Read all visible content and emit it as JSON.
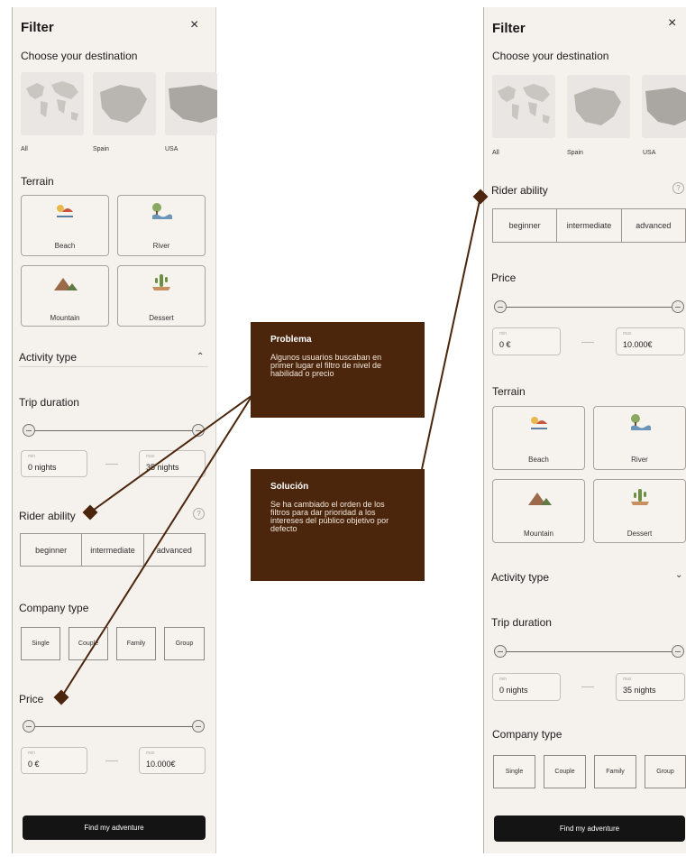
{
  "filter_title": "Filter",
  "close_glyph": "×",
  "destination_heading": "Choose your destination",
  "destinations": [
    "All",
    "Spain",
    "USA"
  ],
  "terrain_heading": "Terrain",
  "terrains": [
    "Beach",
    "River",
    "Mountain",
    "Dessert"
  ],
  "activity_heading": "Activity type",
  "trip_heading": "Trip duration",
  "trip_min_label": "min",
  "trip_max_label": "max",
  "trip_min": "0 nights",
  "trip_max": "35 nights",
  "rider_heading": "Rider ability",
  "rider_help": "?",
  "rider_levels": [
    "beginner",
    "intermediate",
    "advanced"
  ],
  "company_heading": "Company type",
  "company_types": [
    "Single",
    "Couple",
    "Family",
    "Group"
  ],
  "price_heading": "Price",
  "price_min_label": "min",
  "price_max_label": "max",
  "price_min": "0 €",
  "price_max": "10.000€",
  "cta_label": "Find my adventure",
  "problem": {
    "title": "Problema",
    "text": "Algunos usuarios buscaban en primer lugar el filtro de nivel de habilidad o precio"
  },
  "solution": {
    "title": "Solución",
    "text": "Se ha cambiado el orden de los filtros para dar prioridad a los intereses del público objetivo por defecto"
  },
  "colors": {
    "panel_bg": "#f5f1ec",
    "note_bg": "#4b260d",
    "connector": "#4b260d",
    "button_bg": "#141414"
  }
}
